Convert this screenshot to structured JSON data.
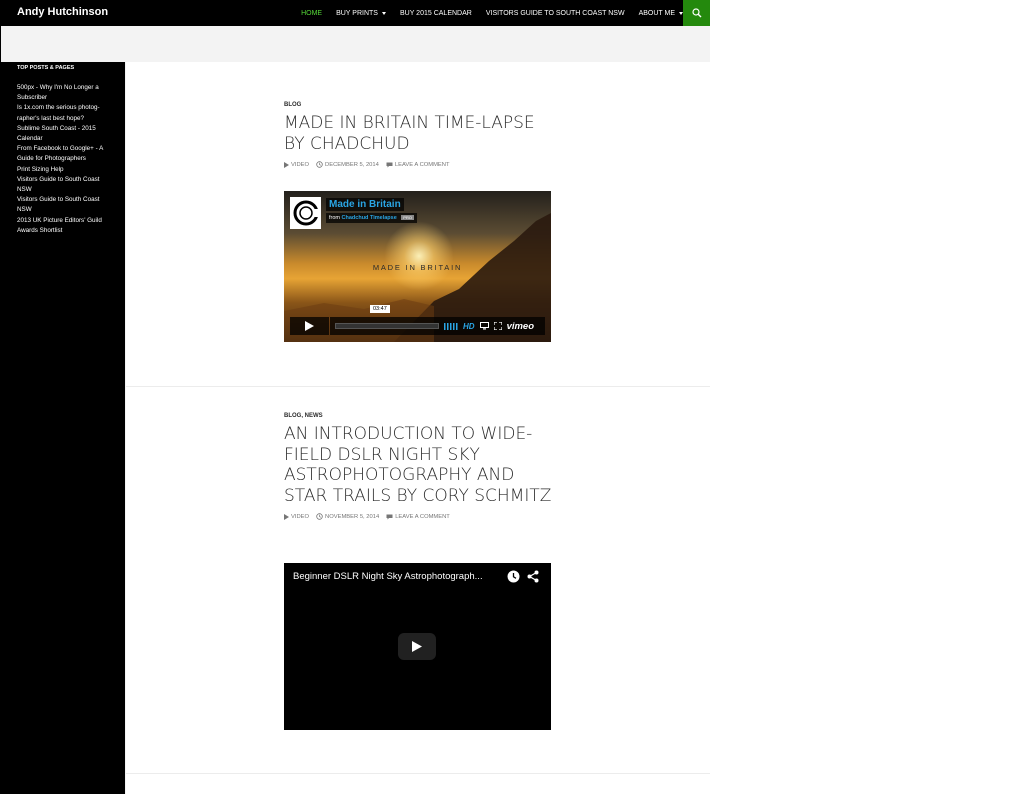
{
  "site": {
    "title": "Andy Hutchinson"
  },
  "nav": {
    "items": [
      {
        "label": "HOME"
      },
      {
        "label": "BUY PRINTS"
      },
      {
        "label": "BUY 2015 CALENDAR"
      },
      {
        "label": "VISITORS GUIDE TO SOUTH COAST NSW"
      },
      {
        "label": "ABOUT ME"
      }
    ]
  },
  "sidebar": {
    "widget_title": "TOP POSTS & PAGES",
    "items": [
      {
        "label": "500px - Why I'm No Longer a Subscriber"
      },
      {
        "label": "Is 1x.com the serious photog-rapher's last best hope?"
      },
      {
        "label": "Sublime South Coast - 2015 Calendar"
      },
      {
        "label": "From Facebook to Google+ - A Guide for Photographers"
      },
      {
        "label": "Print Sizing Help"
      },
      {
        "label": "Visitors Guide to South Coast NSW"
      },
      {
        "label": "Visitors Guide to South Coast NSW"
      },
      {
        "label": "2013 UK Picture Editors' Guild Awards Shortlist"
      }
    ]
  },
  "posts": [
    {
      "categories": "BLOG",
      "title": "MADE IN BRITAIN TIME-LAPSE BY CHADCHUD",
      "meta": {
        "format": "VIDEO",
        "date": "DECEMBER 5, 2014",
        "comment": "LEAVE A COMMENT"
      },
      "video": {
        "title": "Made in Britain",
        "byline_from": "from",
        "byline_author": "Chadchud Timelapse",
        "badge": "PRO",
        "overlay_text": "MADE IN BRITAIN",
        "time_tooltip": "03:47",
        "hd_label": "HD",
        "brand": "vimeo"
      }
    },
    {
      "categories": "BLOG, NEWS",
      "title": "AN INTRODUCTION TO WIDE-FIELD DSLR NIGHT SKY ASTROPHOTOGRAPHY AND STAR TRAILS BY CORY SCHMITZ",
      "meta": {
        "format": "VIDEO",
        "date": "NOVEMBER 5, 2014",
        "comment": "LEAVE A COMMENT"
      },
      "video": {
        "title": "Beginner DSLR Night Sky Astrophotograph..."
      }
    }
  ],
  "colors": {
    "accent_green": "#24890d",
    "nav_active": "#55d737",
    "vimeo_blue": "#2aa5e4"
  }
}
